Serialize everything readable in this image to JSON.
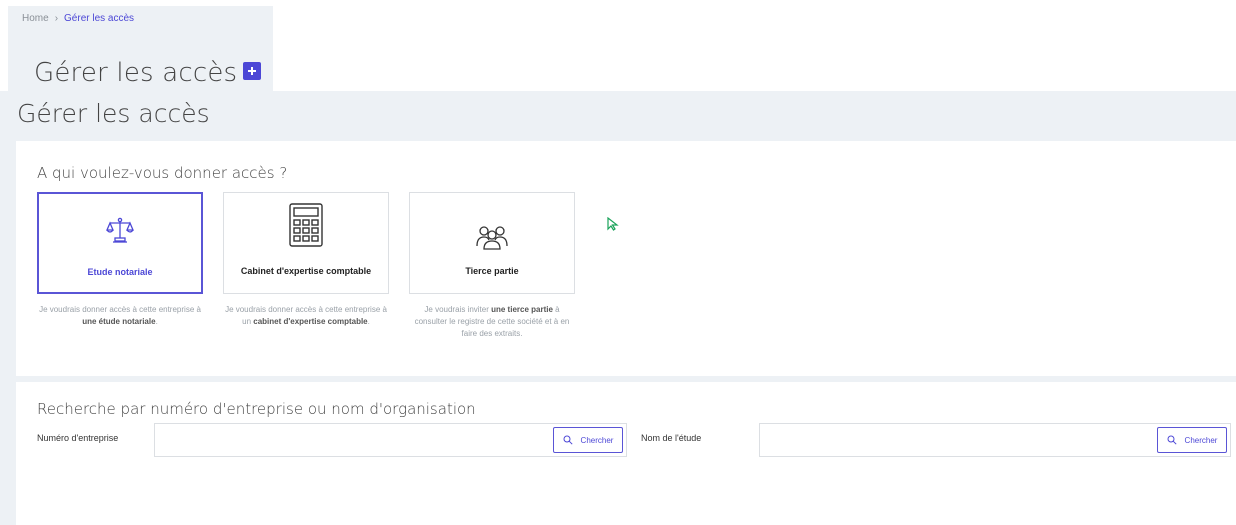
{
  "breadcrumb": {
    "home": "Home",
    "separator": "›",
    "current": "Gérer les accès"
  },
  "page_title": "Gérer les accès",
  "section_title": "Gérer les accès",
  "access": {
    "question": "A qui voulez-vous donner accès ?",
    "cards": [
      {
        "label": "Etude notariale",
        "icon": "scales-icon",
        "selected": true,
        "desc_pre": "Je voudrais donner accès à cette entreprise à ",
        "desc_bold": "une étude notariale",
        "desc_post": "."
      },
      {
        "label": "Cabinet d'expertise comptable",
        "icon": "calculator-icon",
        "selected": false,
        "desc_pre": "Je voudrais donner accès à cette entreprise à un ",
        "desc_bold": "cabinet d'expertise comptable",
        "desc_post": "."
      },
      {
        "label": "Tierce partie",
        "icon": "people-group-icon",
        "selected": false,
        "desc_pre": "Je voudrais inviter ",
        "desc_bold": "une tierce partie",
        "desc_post": " à consulter le registre de cette société et à en faire des extraits."
      }
    ]
  },
  "search": {
    "title": "Recherche par numéro d'entreprise ou nom d'organisation",
    "company_number_label": "Numéro d'entreprise",
    "company_number_value": "",
    "study_name_label": "Nom de l'étude",
    "study_name_value": "",
    "button_label": "Chercher"
  },
  "colors": {
    "accent": "#4c47d6",
    "band": "#edf1f5",
    "cursor": "#1aa35a"
  }
}
